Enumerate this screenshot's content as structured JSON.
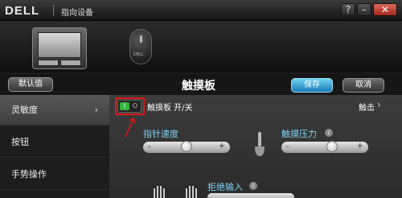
{
  "window": {
    "brand": "DELL",
    "title": "指向设备",
    "controls": {
      "help": "?",
      "minimize": "–",
      "close": "✕"
    }
  },
  "devices": [
    {
      "name": "touchpad",
      "icon": "touchpad-icon"
    },
    {
      "name": "mouse",
      "icon": "mouse-icon",
      "brand": "DELL"
    }
  ],
  "header": {
    "default_label": "默认值",
    "title": "触摸板",
    "save_label": "保存",
    "cancel_label": "取消"
  },
  "sidebar": {
    "items": [
      {
        "label": "灵敏度",
        "active": true,
        "arrow": "›"
      },
      {
        "label": "按钮",
        "active": false
      },
      {
        "label": "手势操作",
        "active": false
      }
    ]
  },
  "content": {
    "toggle": {
      "on_text": "I",
      "off_text": "O",
      "label": "触摸板 开/关",
      "state": "on"
    },
    "touch_link": "触击",
    "touch_chevron": "›",
    "pointer_speed": {
      "label": "指针速度",
      "minus": "-",
      "plus": "+",
      "value": 0.5
    },
    "touch_pressure": {
      "label": "触摸压力",
      "minus": "-",
      "plus": "+",
      "value": 0.6,
      "info": "i"
    },
    "palm_rejection": {
      "label": "拒绝输入",
      "info": "i"
    }
  },
  "colors": {
    "accent_blue": "#7fd2f2",
    "save_button": "#2a8fcb",
    "toggle_on": "#38b43c",
    "highlight_red": "#e01818"
  }
}
